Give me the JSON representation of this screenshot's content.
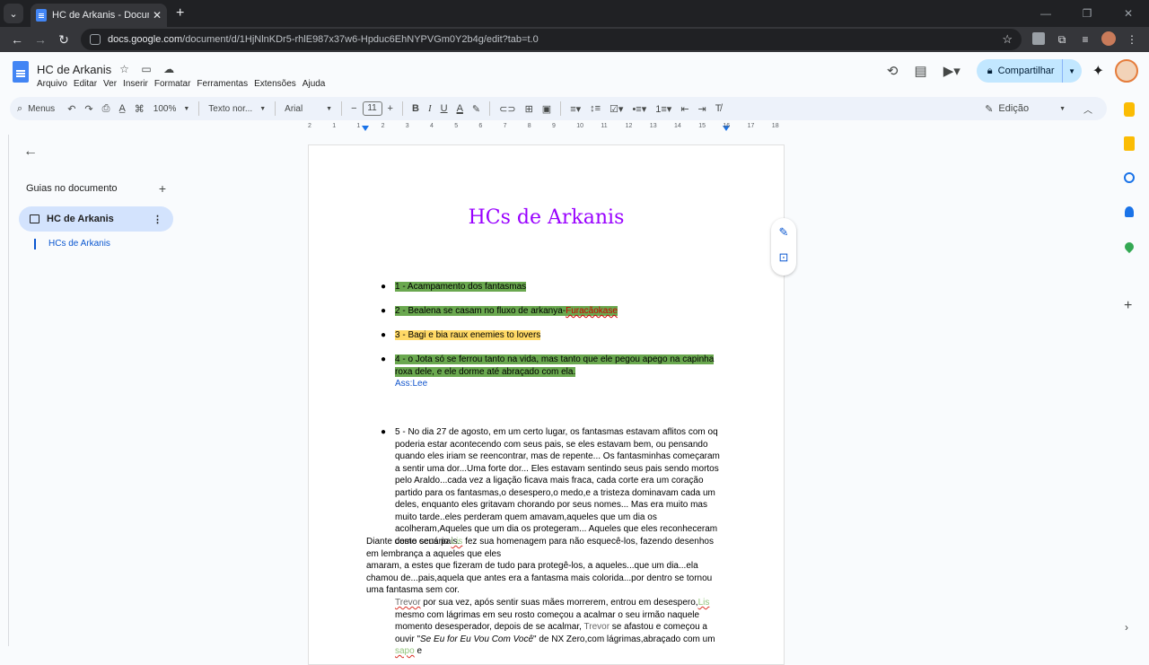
{
  "browser": {
    "tab_title": "HC de Arkanis - Documentos G",
    "url_host": "docs.google.com",
    "url_path": "/document/d/1HjNlnKDr5-rhlE987x37w6-Hpduc6EhNYPVGm0Y2b4g/edit?tab=t.0"
  },
  "docs": {
    "title": "HC de Arkanis",
    "menus": [
      "Arquivo",
      "Editar",
      "Ver",
      "Inserir",
      "Formatar",
      "Ferramentas",
      "Extensões",
      "Ajuda"
    ],
    "share_label": "Compartilhar"
  },
  "toolbar": {
    "search_label": "Menus",
    "zoom": "100%",
    "style": "Texto nor...",
    "font": "Arial",
    "font_size": "11",
    "mode": "Edição"
  },
  "outline": {
    "header": "Guias no documento",
    "tab_name": "HC de Arkanis",
    "heading": "HCs de Arkanis"
  },
  "ruler": [
    "2",
    "1",
    "1",
    "2",
    "3",
    "4",
    "5",
    "6",
    "7",
    "8",
    "9",
    "10",
    "11",
    "12",
    "13",
    "14",
    "15",
    "16",
    "17",
    "18"
  ],
  "document": {
    "heading": "HCs de Arkanis",
    "item1": "1 - Acampamento dos fantasmas",
    "item2_a": "2 - Bealena se casam no fluxo de arkanya-",
    "item2_b": "Furacãokase",
    "item3": "3 - Bagi e bia raux enemies to lovers",
    "item4": "4 - o Jota só se ferrou tanto na vida, mas tanto que ele pegou apego na capinha roxa dele, e ele dorme até abraçado com ela.",
    "item4_sign": "Ass:Lee",
    "item5": "5 - No dia 27 de agosto, em um certo lugar, os fantasmas estavam aflitos com oq poderia estar acontecendo com seus pais, se eles estavam bem, ou pensando quando eles iriam se reencontrar, mas de repente... Os fantasminhas começaram a sentir uma dor...Uma forte dor... Eles estavam sentindo seus pais sendo mortos pelo Araldo...cada vez a ligação ficava mais fraca, cada corte era um coração partido para os fantasmas,o desespero,o medo,e a tristeza dominavam cada um deles, enquanto eles gritavam chorando por seus nomes... Mas era muito mas muito tarde..eles perderam quem amavam,aqueles que um dia os acolheram,Aqueles que um dia os protegeram... Aqueles que eles reconheceram como seus pais.",
    "para1_a": "Diante deste cenário ",
    "para1_lis": "Lis",
    "para1_b": " fez sua      homenagem para não esquecê-los, fazendo desenhos em lembrança a aqueles que eles",
    "para2": "amaram, a estes que fizeram de tudo para protegê-los, a aqueles...que um dia...ela chamou de...pais,aquela que antes era a fantasma mais colorida...por dentro se tornou uma fantasma sem cor.",
    "para3_trevor": "Trevor",
    "para3_a": " por sua vez, após sentir suas mães morrerem, entrou em desespero,",
    "para3_lis": "Lis",
    "para3_b": " mesmo com lágrimas em seu rosto começou a acalmar o seu irmão naquele momento desesperador, depois de se acalmar, ",
    "para3_trevor2": "Trevor",
    "para3_c": " se afastou e começou a ouvir \"",
    "para3_song": "Se Eu for Eu Vou Com Você",
    "para3_d": "\" de NX Zero,com lágrimas,abraçado com um ",
    "para3_sapo": "sapo",
    "para3_e": " e"
  }
}
